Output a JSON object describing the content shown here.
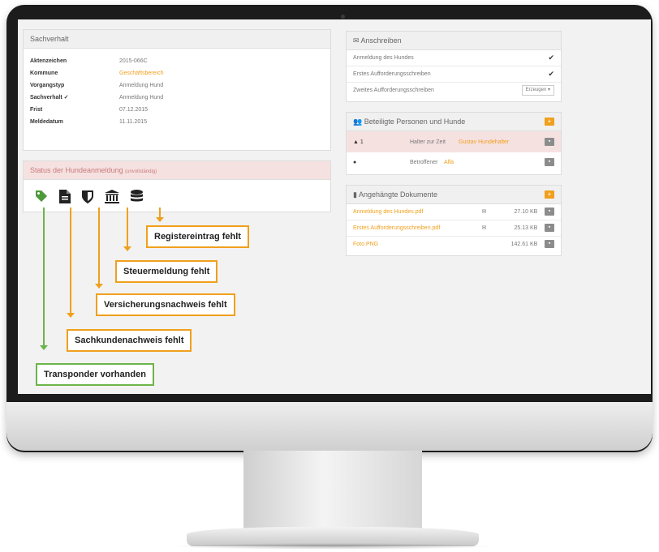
{
  "case_panel": {
    "title": "Sachverhalt",
    "rows": [
      {
        "label": "Aktenzeichen",
        "value": "2015-066C",
        "orange": false
      },
      {
        "label": "Kommune",
        "value": "Geschäftsbereich",
        "orange": true
      },
      {
        "label": "Vorgangstyp",
        "value": "Anmeldung Hund",
        "orange": false
      },
      {
        "label": "Sachverhalt ✓",
        "value": "Anmeldung Hund",
        "orange": false
      },
      {
        "label": "Frist",
        "value": "07.12.2015",
        "orange": false
      },
      {
        "label": "Meldedatum",
        "value": "11.11.2015",
        "orange": false
      }
    ]
  },
  "status_panel": {
    "title": "Status der Hundeanmeldung",
    "subtitle": "(unvollständig)",
    "icons": [
      "tag-icon",
      "document-icon",
      "shield-icon",
      "bank-icon",
      "database-icon"
    ]
  },
  "letters_panel": {
    "title": "Anschreiben",
    "items": [
      {
        "label": "Anmeldung des Hundes",
        "status": "✔"
      },
      {
        "label": "Erstes Aufforderungsschreiben",
        "status": "✔"
      },
      {
        "label": "Zweites Aufforderungsschreiben",
        "status": "Erzeugen ▾"
      }
    ]
  },
  "persons_panel": {
    "title": "Beteiligte Personen und Hunde",
    "add_label": "+",
    "rows": [
      {
        "icon": "▲ 1",
        "role": "Halter zur Zeit",
        "name": "Gustav Hundehalter",
        "action": "▪"
      },
      {
        "icon": "●",
        "role": "Betroffener",
        "name": "Alfa",
        "action": "▪"
      }
    ]
  },
  "docs_panel": {
    "title": "Angehängte Dokumente",
    "add_label": "+",
    "files": [
      {
        "name": "Anmeldung des Hundes.pdf",
        "mail": "✉",
        "size": "27.10 KB"
      },
      {
        "name": "Erstes Aufforderungsschreiben.pdf",
        "mail": "✉",
        "size": "25.13 KB"
      },
      {
        "name": "Foto.PNG",
        "mail": "",
        "size": "142.61 KB"
      }
    ]
  },
  "callouts": {
    "register": "Registereintrag fehlt",
    "tax": "Steuermeldung fehlt",
    "insurance": "Versicherungsnachweis fehlt",
    "expertise": "Sachkundenachweis fehlt",
    "transponder": "Transponder vorhanden"
  },
  "colors": {
    "accent": "#f0a01c",
    "green": "#6cb44a",
    "status_bg": "#f6e1e1"
  }
}
